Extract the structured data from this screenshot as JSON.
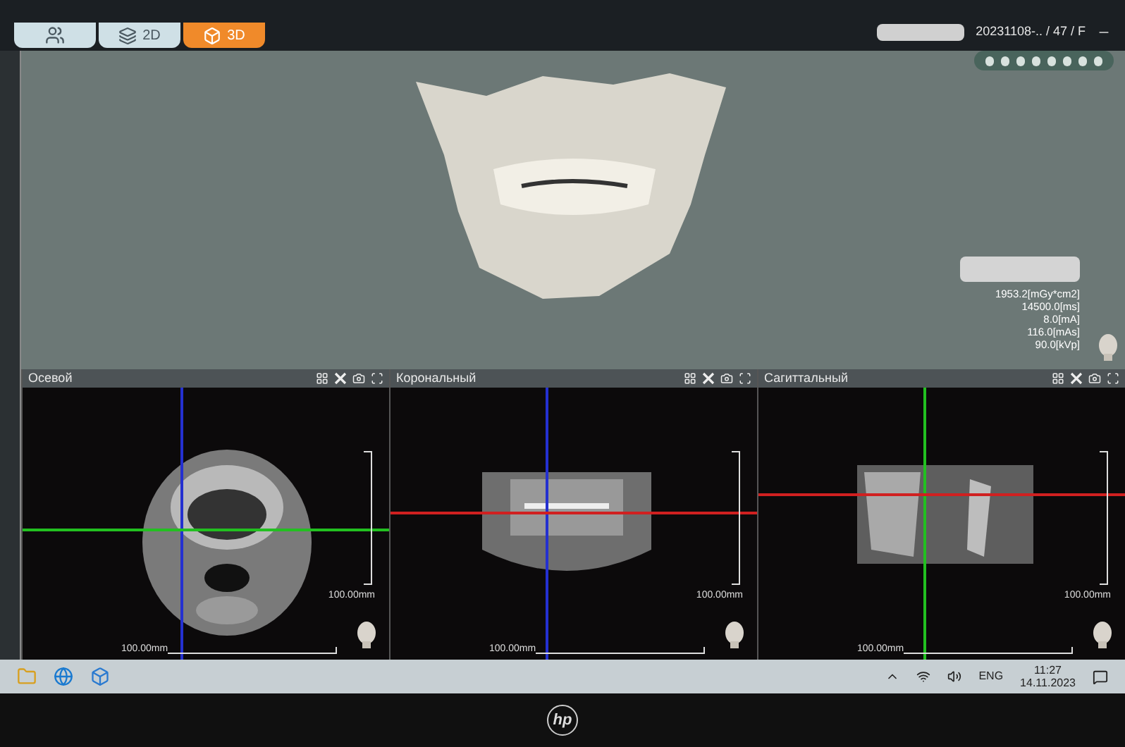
{
  "mode_tabs": [
    {
      "kind": "patients",
      "selected": false
    },
    {
      "kind": "slices",
      "label": "2D",
      "selected": false
    },
    {
      "kind": "volume",
      "label": "3D",
      "selected": true
    }
  ],
  "study": {
    "id": "20231108-.. / 47 / F"
  },
  "dose_readings": [
    "1953.2[mGy*cm2]",
    "14500.0[ms]",
    "8.0[mA]",
    "116.0[mAs]",
    "90.0[kVp]"
  ],
  "panels": [
    {
      "kind": "axial",
      "title": "Осевой",
      "scale_vertical": "100.00mm",
      "scale_horizontal": "100.00mm"
    },
    {
      "kind": "coronal",
      "title": "Корональный",
      "scale_vertical": "100.00mm",
      "scale_horizontal": "100.00mm"
    },
    {
      "kind": "sagittal",
      "title": "Сагиттальный",
      "scale_vertical": "100.00mm",
      "scale_horizontal": "100.00mm"
    }
  ],
  "taskbar": {
    "language": "ENG",
    "time": "11:27",
    "date": "14.11.2023"
  },
  "monitor": {
    "logo": "hp"
  }
}
